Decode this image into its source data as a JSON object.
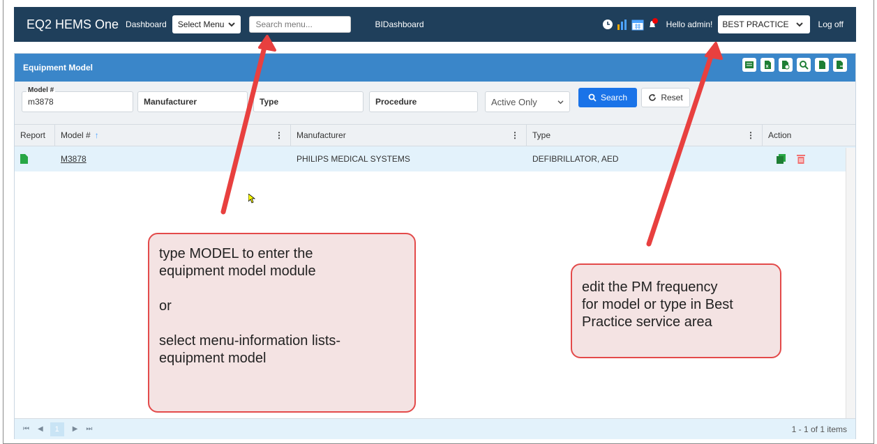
{
  "nav": {
    "brand": "EQ2 HEMS One",
    "dashboard": "Dashboard",
    "select_menu": "Select Menu",
    "search_placeholder": "Search menu...",
    "bidashboard": "BIDashboard",
    "hello": "Hello admin!",
    "profile_select": "BEST PRACTICE",
    "logoff": "Log off"
  },
  "panel": {
    "title": "Equipment Model",
    "toolbar_icons": [
      "excel-export-icon",
      "excel-icon",
      "settings-doc-icon",
      "search-user-icon",
      "document-icon",
      "document-export-icon"
    ]
  },
  "filters": {
    "model_label": "Model #",
    "model_value": "m3878",
    "manufacturer_label": "Manufacturer",
    "type_label": "Type",
    "procedure_label": "Procedure",
    "status_value": "Active Only",
    "search_button": "Search",
    "reset_button": "Reset"
  },
  "table": {
    "columns": [
      "Report",
      "Model #",
      "Manufacturer",
      "Type",
      "Action"
    ],
    "sort_indicator": "↑",
    "rows": [
      {
        "model": "M3878",
        "manufacturer": "PHILIPS MEDICAL SYSTEMS",
        "type": "DEFIBRILLATOR, AED"
      }
    ]
  },
  "pager": {
    "current_page": "1",
    "info": "1 - 1 of 1 items"
  },
  "callouts": {
    "left": "type MODEL to enter the\nequipment model module\n\nor\n\nselect menu-information lists-\nequipment model",
    "right": "edit the PM frequency\nfor model or type in Best\nPractice service area"
  },
  "colors": {
    "nav_bg": "#1f3f5b",
    "panel_head": "#3a86c9",
    "accent_button": "#1a73e8",
    "row_highlight": "#e3f2fb",
    "callout_border": "#e34a4a",
    "callout_fill": "#f4e3e3"
  }
}
